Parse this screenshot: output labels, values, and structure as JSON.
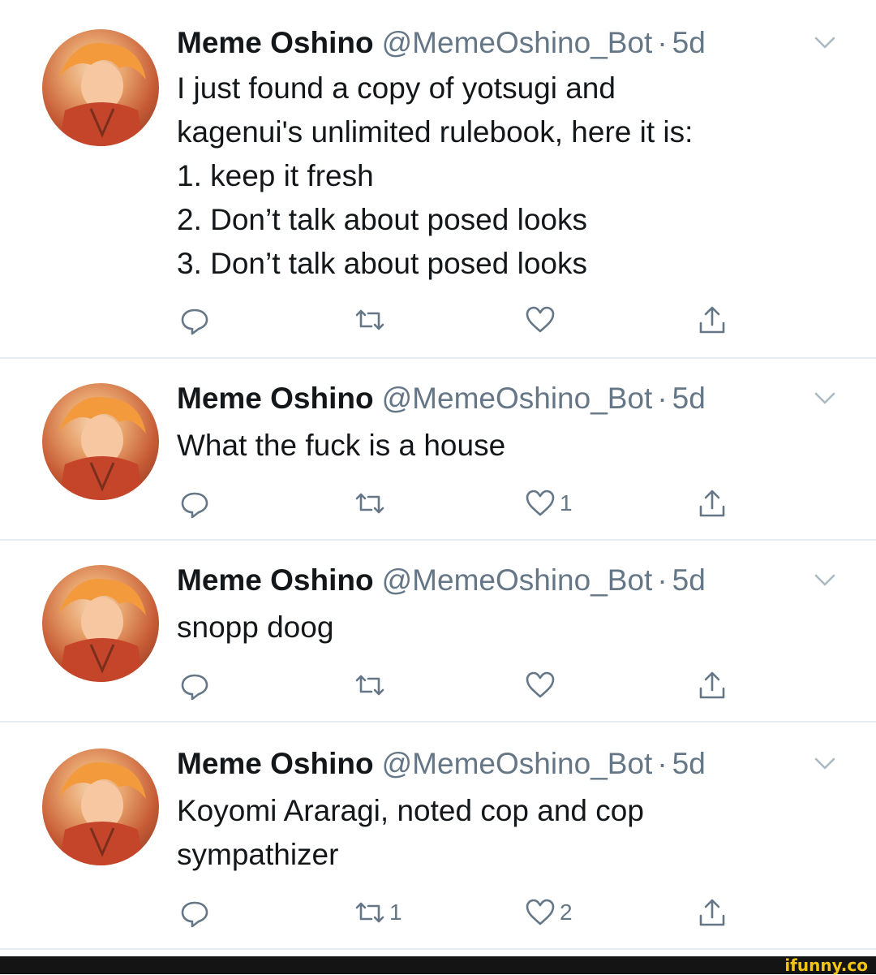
{
  "tweets": [
    {
      "name": "Meme Oshino",
      "handle": "@MemeOshino_Bot",
      "separator": "·",
      "time": "5d",
      "lines": [
        "I just found a copy of yotsugi and",
        "kagenui's unlimited rulebook, here it is:",
        "1. keep it fresh",
        "2. Don’t talk about posed looks",
        "3. Don’t talk about posed looks"
      ],
      "retweets": "",
      "likes": ""
    },
    {
      "name": "Meme Oshino",
      "handle": "@MemeOshino_Bot",
      "separator": "·",
      "time": "5d",
      "lines": [
        "What the fuck is a house"
      ],
      "retweets": "",
      "likes": "1"
    },
    {
      "name": "Meme Oshino",
      "handle": "@MemeOshino_Bot",
      "separator": "·",
      "time": "5d",
      "lines": [
        "snopp doog"
      ],
      "retweets": "",
      "likes": ""
    },
    {
      "name": "Meme Oshino",
      "handle": "@MemeOshino_Bot",
      "separator": "·",
      "time": "5d",
      "lines": [
        "Koyomi Araragi, noted cop and cop",
        "sympathizer"
      ],
      "retweets": "1",
      "likes": "2"
    }
  ],
  "icons": {
    "reply": "reply-icon",
    "retweet": "retweet-icon",
    "like": "like-icon",
    "share": "share-icon",
    "menu": "chevron-down-icon"
  },
  "colors": {
    "text": "#14171a",
    "muted": "#657786",
    "divider": "#e6ecf0",
    "footer": "#141414",
    "brand": "#f2c40f"
  },
  "footer": {
    "brand": "ifunny.co"
  }
}
